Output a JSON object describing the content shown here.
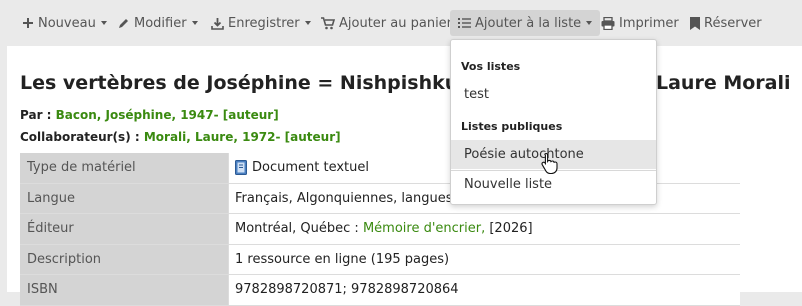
{
  "toolbar": {
    "new_label": "Nouveau",
    "edit_label": "Modifier",
    "save_label": "Enregistrer",
    "cart_label": "Ajouter au panier",
    "list_label": "Ajouter à la liste",
    "print_label": "Imprimer",
    "reserve_label": "Réserver"
  },
  "record": {
    "title_left": "Les vertèbres de Joséphine = Nishpishkun /",
    "title_right": "Laure Morali",
    "by_label": "Par :",
    "author_link": "Bacon, Joséphine, 1947- [auteur]",
    "collab_label": "Collaborateur(s) :",
    "collab_link": "Morali, Laure, 1972- [auteur]"
  },
  "details": {
    "material_label": "Type de matériel",
    "material_value": "Document textuel",
    "language_label": "Langue",
    "language_value": "Français, Algonquiennes, langues.",
    "publisher_label": "Éditeur",
    "publisher_place": "Montréal, Québec :",
    "publisher_link": "Mémoire d'encrier,",
    "publisher_year": "[2026]",
    "description_label": "Description",
    "description_value": "1 ressource en ligne (195 pages)",
    "isbn_label": "ISBN",
    "isbn_value": "9782898720871; 9782898720864"
  },
  "dropdown": {
    "my_lists_header": "Vos listes",
    "my_list_1": "test",
    "public_lists_header": "Listes publiques",
    "public_list_1": "Poésie autochtone",
    "new_list": "Nouvelle liste"
  },
  "icons": {
    "new": "plus-icon",
    "edit": "pencil-icon",
    "save": "download-icon",
    "cart": "cart-icon",
    "list": "list-icon",
    "print": "print-icon",
    "reserve": "bookmark-icon",
    "material": "book-icon"
  },
  "colors": {
    "link": "#3a8a10",
    "toolbar_text": "#555555",
    "active_button_bg": "#d4d4d4",
    "label_bg": "#d4d4d4",
    "page_bg": "#eaeaea"
  }
}
